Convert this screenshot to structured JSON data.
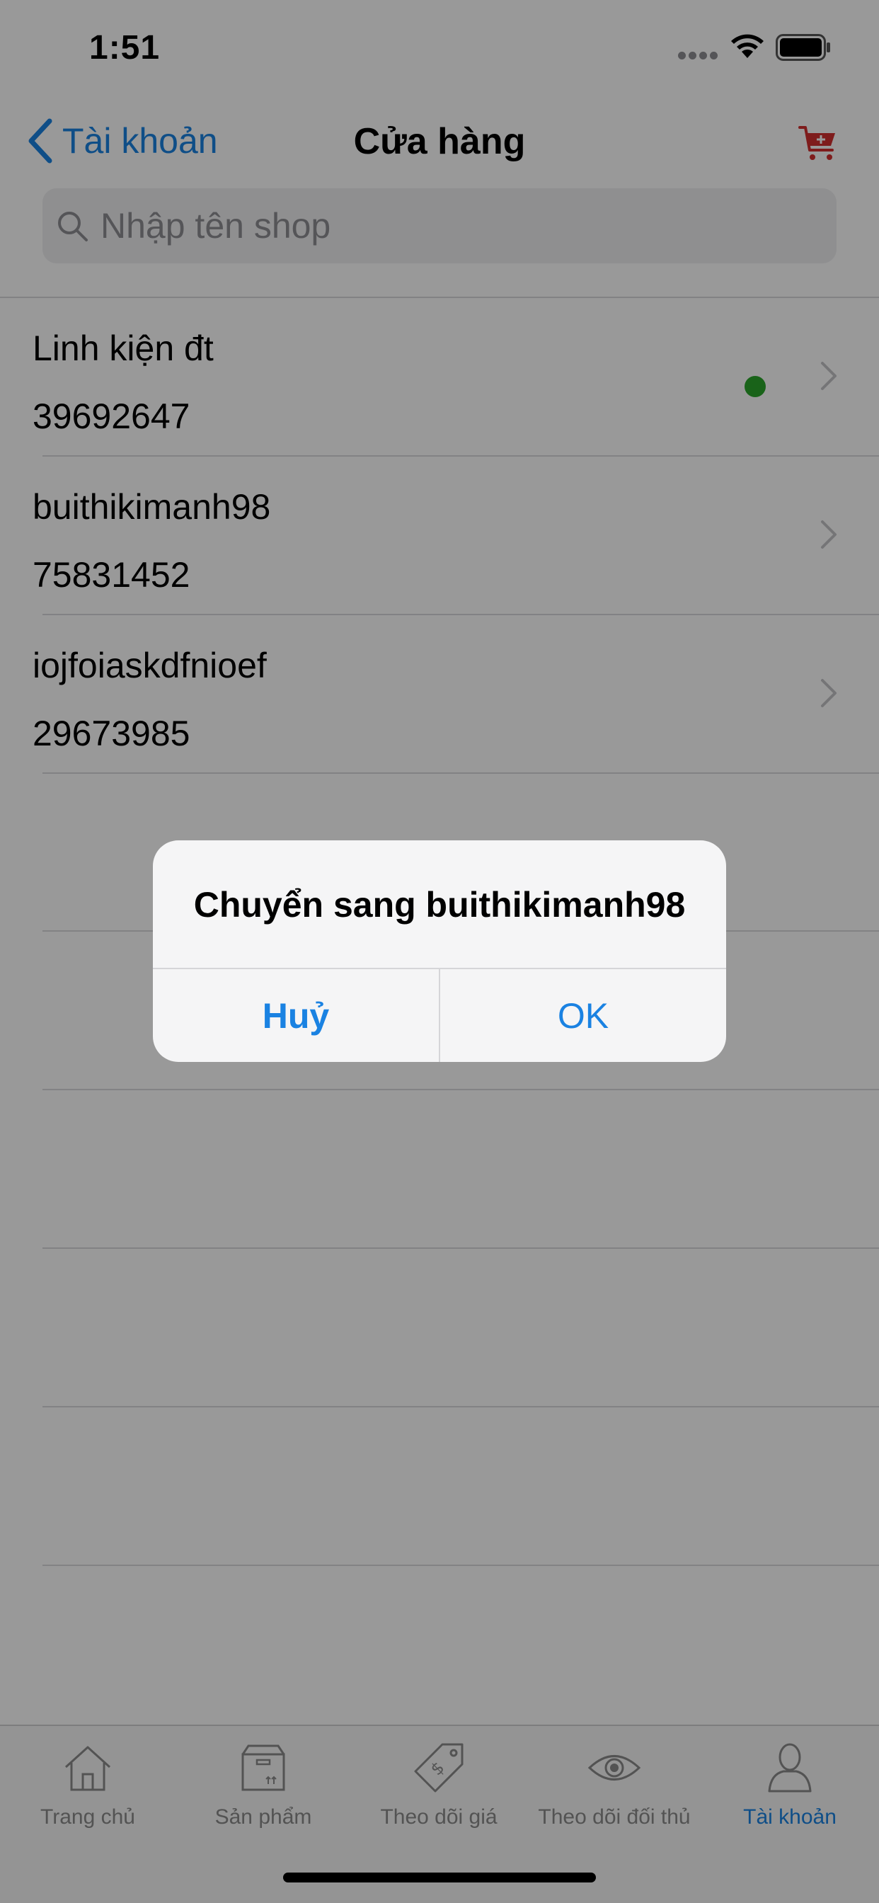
{
  "status_bar": {
    "time": "1:51"
  },
  "nav": {
    "back_label": "Tài khoản",
    "title": "Cửa hàng",
    "cart_icon": "cart-plus-icon"
  },
  "search": {
    "placeholder": "Nhập tên shop",
    "value": ""
  },
  "shops": [
    {
      "name": "Linh kiện đt",
      "id": "39692647",
      "active": true
    },
    {
      "name": "buithikimanh98",
      "id": "75831452",
      "active": false
    },
    {
      "name": "iojfoiaskdfnioef",
      "id": "29673985",
      "active": false
    }
  ],
  "alert": {
    "title": "Chuyển sang buithikimanh98",
    "cancel_label": "Huỷ",
    "ok_label": "OK"
  },
  "tabs": [
    {
      "label": "Trang chủ",
      "icon": "home-icon",
      "active": false
    },
    {
      "label": "Sản phẩm",
      "icon": "box-icon",
      "active": false
    },
    {
      "label": "Theo dõi giá",
      "icon": "price-tag-icon",
      "active": false
    },
    {
      "label": "Theo dõi đối thủ",
      "icon": "eye-icon",
      "active": false
    },
    {
      "label": "Tài khoản",
      "icon": "user-icon",
      "active": true
    }
  ],
  "colors": {
    "accent": "#1a82e2",
    "active_dot": "#2aa52a",
    "cart": "#d32f2f"
  }
}
